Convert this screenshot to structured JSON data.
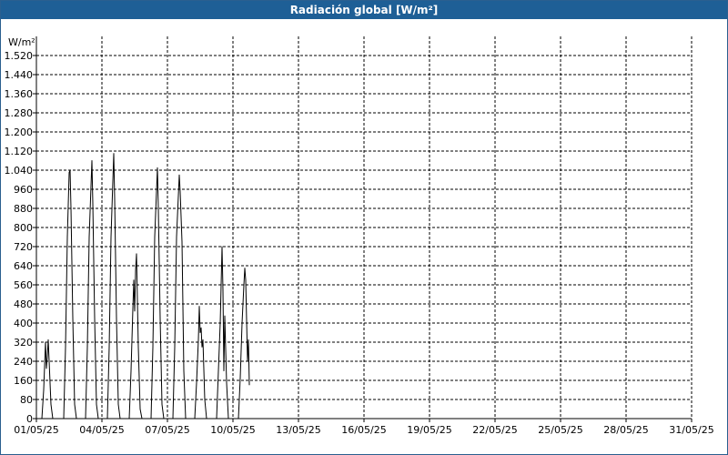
{
  "chart_data": {
    "type": "line",
    "title": "Radiación global [W/m²]",
    "ylabel": "W/m²",
    "xlabel": "",
    "ylim": [
      0,
      1600
    ],
    "xlim": [
      "01/05/25",
      "31/05/25"
    ],
    "grid": true,
    "y_ticks": [
      "0",
      "80",
      "160",
      "240",
      "320",
      "400",
      "480",
      "560",
      "640",
      "720",
      "800",
      "880",
      "960",
      "1.040",
      "1.120",
      "1.200",
      "1.280",
      "1.360",
      "1.440",
      "1.520"
    ],
    "x_ticks": [
      "01/05/25",
      "04/05/25",
      "07/05/25",
      "10/05/25",
      "13/05/25",
      "16/05/25",
      "19/05/25",
      "22/05/25",
      "25/05/25",
      "28/05/25",
      "31/05/25"
    ],
    "series": [
      {
        "color": "#000000",
        "points": [
          [
            "2025-05-01 00:00",
            0
          ],
          [
            "2025-05-01 06:00",
            0
          ],
          [
            "2025-05-01 08:00",
            120
          ],
          [
            "2025-05-01 10:00",
            320
          ],
          [
            "2025-05-01 11:00",
            210
          ],
          [
            "2025-05-01 12:00",
            260
          ],
          [
            "2025-05-01 13:00",
            330
          ],
          [
            "2025-05-01 14:00",
            240
          ],
          [
            "2025-05-01 16:00",
            60
          ],
          [
            "2025-05-01 18:00",
            0
          ],
          [
            "2025-05-02 06:00",
            0
          ],
          [
            "2025-05-02 08:00",
            300
          ],
          [
            "2025-05-02 10:00",
            760
          ],
          [
            "2025-05-02 12:00",
            1030
          ],
          [
            "2025-05-02 13:00",
            1040
          ],
          [
            "2025-05-02 14:00",
            880
          ],
          [
            "2025-05-02 16:00",
            420
          ],
          [
            "2025-05-02 18:00",
            60
          ],
          [
            "2025-05-02 20:00",
            0
          ],
          [
            "2025-05-03 06:00",
            0
          ],
          [
            "2025-05-03 08:00",
            300
          ],
          [
            "2025-05-03 10:00",
            760
          ],
          [
            "2025-05-03 13:00",
            1080
          ],
          [
            "2025-05-03 14:00",
            900
          ],
          [
            "2025-05-03 16:00",
            420
          ],
          [
            "2025-05-03 18:00",
            60
          ],
          [
            "2025-05-03 20:00",
            0
          ],
          [
            "2025-05-04 06:00",
            0
          ],
          [
            "2025-05-04 08:00",
            300
          ],
          [
            "2025-05-04 10:00",
            760
          ],
          [
            "2025-05-04 13:00",
            1110
          ],
          [
            "2025-05-04 14:00",
            920
          ],
          [
            "2025-05-04 16:00",
            420
          ],
          [
            "2025-05-04 18:00",
            60
          ],
          [
            "2025-05-04 20:00",
            0
          ],
          [
            "2025-05-05 06:00",
            0
          ],
          [
            "2025-05-05 08:00",
            200
          ],
          [
            "2025-05-05 10:00",
            460
          ],
          [
            "2025-05-05 11:00",
            580
          ],
          [
            "2025-05-05 12:00",
            450
          ],
          [
            "2025-05-05 13:00",
            620
          ],
          [
            "2025-05-05 14:00",
            690
          ],
          [
            "2025-05-05 16:00",
            300
          ],
          [
            "2025-05-05 18:00",
            40
          ],
          [
            "2025-05-05 20:00",
            0
          ],
          [
            "2025-05-06 06:00",
            0
          ],
          [
            "2025-05-06 08:00",
            300
          ],
          [
            "2025-05-06 10:00",
            760
          ],
          [
            "2025-05-06 13:00",
            1050
          ],
          [
            "2025-05-06 14:00",
            880
          ],
          [
            "2025-05-06 16:00",
            420
          ],
          [
            "2025-05-06 18:00",
            60
          ],
          [
            "2025-05-06 20:00",
            0
          ],
          [
            "2025-05-07 06:00",
            0
          ],
          [
            "2025-05-07 08:00",
            300
          ],
          [
            "2025-05-07 10:00",
            760
          ],
          [
            "2025-05-07 13:00",
            1020
          ],
          [
            "2025-05-07 14:00",
            950
          ],
          [
            "2025-05-07 16:00",
            740
          ],
          [
            "2025-05-07 18:00",
            200
          ],
          [
            "2025-05-07 20:00",
            0
          ],
          [
            "2025-05-08 06:00",
            0
          ],
          [
            "2025-05-08 08:00",
            150
          ],
          [
            "2025-05-08 10:00",
            330
          ],
          [
            "2025-05-08 11:00",
            470
          ],
          [
            "2025-05-08 12:00",
            360
          ],
          [
            "2025-05-08 13:00",
            380
          ],
          [
            "2025-05-08 14:00",
            300
          ],
          [
            "2025-05-08 15:00",
            330
          ],
          [
            "2025-05-08 17:00",
            80
          ],
          [
            "2025-05-08 19:00",
            0
          ],
          [
            "2025-05-09 06:00",
            0
          ],
          [
            "2025-05-09 08:00",
            200
          ],
          [
            "2025-05-09 10:00",
            400
          ],
          [
            "2025-05-09 12:00",
            720
          ],
          [
            "2025-05-09 13:00",
            540
          ],
          [
            "2025-05-09 14:00",
            200
          ],
          [
            "2025-05-09 15:00",
            430
          ],
          [
            "2025-05-09 17:00",
            150
          ],
          [
            "2025-05-09 19:00",
            0
          ],
          [
            "2025-05-10 06:00",
            0
          ],
          [
            "2025-05-10 08:00",
            170
          ],
          [
            "2025-05-10 10:00",
            400
          ],
          [
            "2025-05-10 12:00",
            560
          ],
          [
            "2025-05-10 13:00",
            630
          ],
          [
            "2025-05-10 14:00",
            580
          ],
          [
            "2025-05-10 16:00",
            240
          ],
          [
            "2025-05-10 17:00",
            330
          ],
          [
            "2025-05-10 18:00",
            140
          ]
        ]
      }
    ]
  }
}
